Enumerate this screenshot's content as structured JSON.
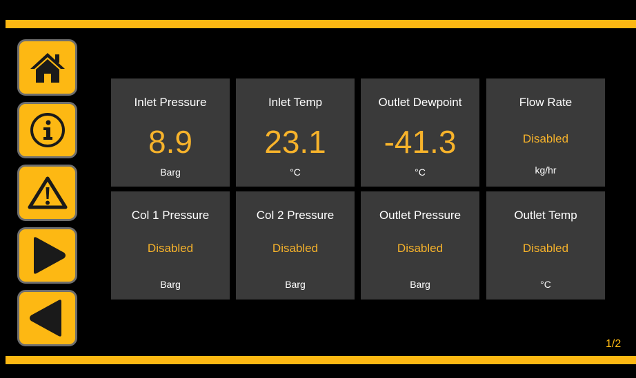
{
  "colors": {
    "accent": "#fdb813",
    "value": "#f7b32b",
    "tile_bg": "#3a3a3a",
    "background": "#000000"
  },
  "nav": [
    {
      "icon": "home-icon"
    },
    {
      "icon": "info-icon"
    },
    {
      "icon": "warning-icon"
    },
    {
      "icon": "play-right-icon"
    },
    {
      "icon": "play-left-icon"
    }
  ],
  "tiles": [
    {
      "label": "Inlet Pressure",
      "value": "8.9",
      "unit": "Barg"
    },
    {
      "label": "Inlet Temp",
      "value": "23.1",
      "unit": "°C"
    },
    {
      "label": "Outlet Dewpoint",
      "value": "-41.3",
      "unit": "°C"
    },
    {
      "label": "Flow Rate",
      "value": "Disabled",
      "unit": "kg/hr"
    },
    {
      "label": "Col 1 Pressure",
      "value": "Disabled",
      "unit": "Barg"
    },
    {
      "label": "Col 2 Pressure",
      "value": "Disabled",
      "unit": "Barg"
    },
    {
      "label": "Outlet Pressure",
      "value": "Disabled",
      "unit": "Barg"
    },
    {
      "label": "Outlet Temp",
      "value": "Disabled",
      "unit": "°C"
    }
  ],
  "page_indicator": "1/2"
}
